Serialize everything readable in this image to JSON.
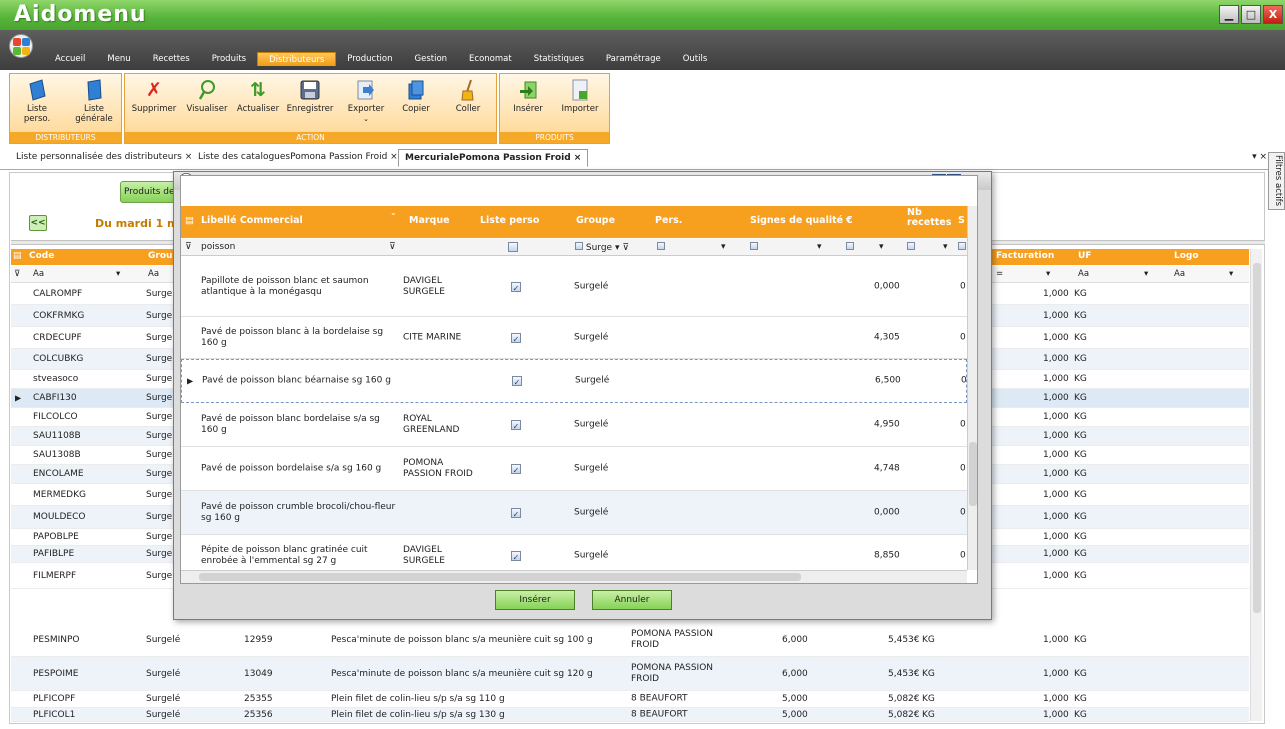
{
  "app": {
    "title": "Aidomenu",
    "minimize": "▁",
    "maximize": "□",
    "close": "X"
  },
  "menu": [
    "Accueil",
    "Menu",
    "Recettes",
    "Produits",
    "Distributeurs",
    "Production",
    "Gestion",
    "Economat",
    "Statistiques",
    "Paramétrage",
    "Outils"
  ],
  "menu_active": "Distributeurs",
  "ribbon": {
    "distributeurs_group": "DISTRIBUTEURS",
    "action_group": "ACTION",
    "produits_group": "PRODUITS",
    "liste_perso": "Liste perso.",
    "liste_generale": "Liste générale",
    "supprimer": "Supprimer",
    "visualiser": "Visualiser",
    "actualiser": "Actualiser",
    "enregistrer": "Enregistrer",
    "exporter": "Exporter",
    "copier": "Copier",
    "coller": "Coller",
    "inserer": "Insérer",
    "importer": "Importer"
  },
  "tabs": [
    "Liste personnalisée des distributeurs",
    "Liste des cataloguesPomona Passion Froid",
    "MercurialePomona Passion Froid"
  ],
  "tab_close": "×",
  "filtres": "Filtres actifs",
  "bg": {
    "produits_btn": "Produits de",
    "back": "<<",
    "date": "Du mardi 1 m",
    "headers": {
      "code": "Code",
      "groupe": "Grou",
      "facturation": "Facturation",
      "uf": "UF",
      "logo": "Logo"
    },
    "filter_aa": "Aa",
    "filter_eq": "=",
    "rows": [
      {
        "code": "CALROMPF",
        "groupe": "Surgel",
        "fact": "1,000",
        "uf": "KG"
      },
      {
        "code": "COKFRMKG",
        "groupe": "Surgel",
        "fact": "1,000",
        "uf": "KG"
      },
      {
        "code": "CRDECUPF",
        "groupe": "Surgel",
        "fact": "1,000",
        "uf": "KG"
      },
      {
        "code": "COLCUBKG",
        "groupe": "Surgel",
        "fact": "1,000",
        "uf": "KG"
      },
      {
        "code": "stveasoco",
        "groupe": "Surgel",
        "fact": "1,000",
        "uf": "KG"
      },
      {
        "code": "CABFI130",
        "groupe": "Surgel",
        "fact": "1,000",
        "uf": "KG"
      },
      {
        "code": "FILCOLCO",
        "groupe": "Surgel",
        "fact": "1,000",
        "uf": "KG"
      },
      {
        "code": "SAU1108B",
        "groupe": "Surgel",
        "fact": "1,000",
        "uf": "KG"
      },
      {
        "code": "SAU1308B",
        "groupe": "Surgel",
        "fact": "1,000",
        "uf": "KG"
      },
      {
        "code": "ENCOLAME",
        "groupe": "Surgel",
        "fact": "1,000",
        "uf": "KG"
      },
      {
        "code": "MERMEDKG",
        "groupe": "Surgel",
        "fact": "1,000",
        "uf": "KG"
      },
      {
        "code": "MOULDECO",
        "groupe": "Surgel",
        "fact": "1,000",
        "uf": "KG"
      },
      {
        "code": "PAPOBLPE",
        "groupe": "Surgel",
        "fact": "1,000",
        "uf": "KG"
      },
      {
        "code": "PAFIBLPE",
        "groupe": "Surgel",
        "fact": "1,000",
        "uf": "KG"
      },
      {
        "code": "FILMERPF",
        "groupe": "Surgel",
        "fact": "1,000",
        "uf": "KG"
      }
    ],
    "full_rows": [
      {
        "code": "PESMINPO",
        "groupe": "Surgelé",
        "num": "12959",
        "libelle": "Pesca'minute de poisson blanc s/a meunière cuit sg 100 g",
        "marque": "POMONA PASSION FROID",
        "cond": "6,000",
        "prix": "5,453€",
        "unit": "KG",
        "fact": "1,000",
        "uf": "KG"
      },
      {
        "code": "PESPOIME",
        "groupe": "Surgelé",
        "num": "13049",
        "libelle": "Pesca'minute de poisson blanc s/a meunière cuit sg 120 g",
        "marque": "POMONA PASSION FROID",
        "cond": "6,000",
        "prix": "5,453€",
        "unit": "KG",
        "fact": "1,000",
        "uf": "KG"
      },
      {
        "code": "PLFICOPF",
        "groupe": "Surgelé",
        "num": "25355",
        "libelle": "Plein filet de colin-lieu s/p s/a sg 110 g",
        "marque": "8 BEAUFORT",
        "cond": "5,000",
        "prix": "5,082€",
        "unit": "KG",
        "fact": "1,000",
        "uf": "KG"
      },
      {
        "code": "PLFICOL1",
        "groupe": "Surgelé",
        "num": "25356",
        "libelle": "Plein filet de colin-lieu s/p s/a sg 130 g",
        "marque": "8 BEAUFORT",
        "cond": "5,000",
        "prix": "5,082€",
        "unit": "KG",
        "fact": "1,000",
        "uf": "KG"
      }
    ]
  },
  "dialog": {
    "headers": {
      "libelle": "Libellé Commercial",
      "marque": "Marque",
      "liste": "Liste perso",
      "groupe": "Groupe",
      "pers": "Pers.",
      "signes": "Signes de qualité",
      "prix": "€",
      "nb": "Nb recettes",
      "s": "S"
    },
    "search": "poisson",
    "groupe_filter": "Surge",
    "rows": [
      {
        "libelle": "Papillote de poisson blanc et saumon atlantique à la monégasqu",
        "marque": "DAVIGEL SURGELE",
        "groupe": "Surgelé",
        "prix": "0,000",
        "nb": "0"
      },
      {
        "libelle": "Pavé de poisson blanc à la bordelaise sg 160 g",
        "marque": "CITE MARINE",
        "groupe": "Surgelé",
        "prix": "4,305",
        "nb": "0"
      },
      {
        "libelle": "Pavé de poisson blanc béarnaise sg 160 g",
        "marque": "",
        "groupe": "Surgelé",
        "prix": "6,500",
        "nb": "0"
      },
      {
        "libelle": "Pavé de poisson blanc bordelaise s/a sg 160 g",
        "marque": "ROYAL GREENLAND",
        "groupe": "Surgelé",
        "prix": "4,950",
        "nb": "0"
      },
      {
        "libelle": "Pavé de poisson bordelaise s/a sg 160 g",
        "marque": "POMONA PASSION FROID",
        "groupe": "Surgelé",
        "prix": "4,748",
        "nb": "0"
      },
      {
        "libelle": "Pavé de poisson crumble brocoli/chou-fleur sg 160 g",
        "marque": "",
        "groupe": "Surgelé",
        "prix": "0,000",
        "nb": "0"
      },
      {
        "libelle": "Pépite de poisson blanc gratinée cuit enrobée à l'emmental sg 27 g",
        "marque": "DAVIGEL SURGELE",
        "groupe": "Surgelé",
        "prix": "8,850",
        "nb": "0"
      }
    ],
    "inserer_btn": "Insérer",
    "annuler_btn": "Annuler"
  }
}
